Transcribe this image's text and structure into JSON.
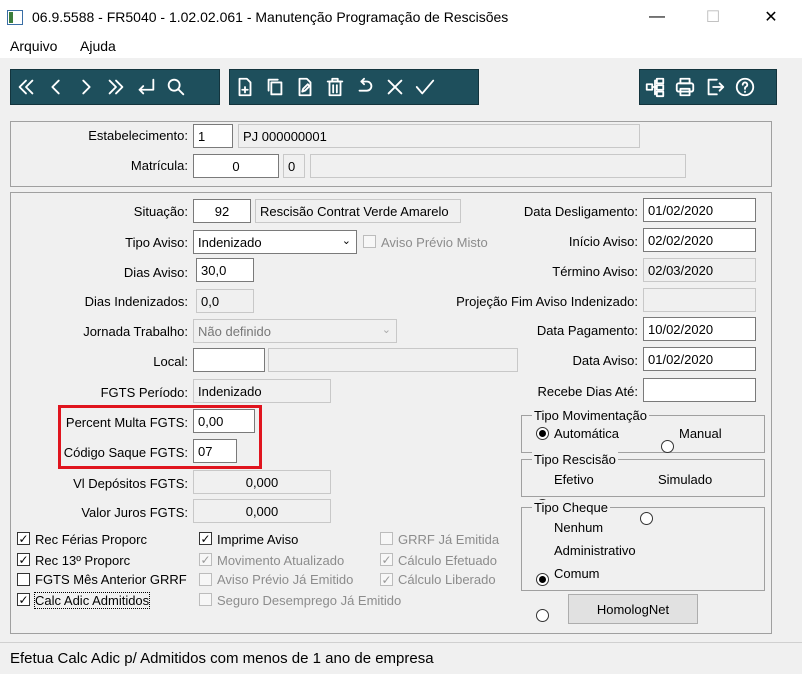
{
  "window": {
    "title": "06.9.5588 - FR5040 - 1.02.02.061 - Manutenção Programação de Rescisões",
    "minimize": "—",
    "maximize": "☐",
    "close": "✕"
  },
  "menu": [
    "Arquivo",
    "Ajuda"
  ],
  "toolbar": {
    "nav_icons": [
      "first-icon",
      "prev-icon",
      "next-icon",
      "last-icon",
      "return-icon",
      "search-icon"
    ],
    "edit_icons": [
      "new-icon",
      "copy-icon",
      "edit-icon",
      "delete-icon",
      "undo-icon",
      "cancel-icon",
      "confirm-icon"
    ],
    "right_icons": [
      "tree-icon",
      "print-icon",
      "exit-icon",
      "help-icon"
    ],
    "color": "#1e4f5c"
  },
  "header": {
    "estabelecimento_label": "Estabelecimento:",
    "estabelecimento_value": "1",
    "estabelecimento_desc": "PJ 000000001",
    "matricula_label": "Matrícula:",
    "matricula_value": "0",
    "matricula_digit": "0",
    "matricula_name": ""
  },
  "form": {
    "situacao_label": "Situação:",
    "situacao_value": "92",
    "situacao_desc": "Rescisão Contrat Verde Amarelo",
    "tipo_aviso_label": "Tipo Aviso:",
    "tipo_aviso_value": "Indenizado",
    "aviso_previo_misto": "Aviso Prévio Misto",
    "dias_aviso_label": "Dias Aviso:",
    "dias_aviso_value": "30,0",
    "dias_indenizados_label": "Dias Indenizados:",
    "dias_indenizados_value": "0,0",
    "jornada_label": "Jornada Trabalho:",
    "jornada_value": "Não definido",
    "local_label": "Local:",
    "local_value": "",
    "local_desc": "",
    "fgts_periodo_label": "FGTS Período:",
    "fgts_periodo_value": "Indenizado",
    "percent_multa_label": "Percent Multa FGTS:",
    "percent_multa_value": "0,00",
    "codigo_saque_label": "Código Saque FGTS:",
    "codigo_saque_value": "07",
    "vl_depositos_label": "Vl Depósitos FGTS:",
    "vl_depositos_value": "0,000",
    "valor_juros_label": "Valor Juros FGTS:",
    "valor_juros_value": "0,000",
    "data_deslig_label": "Data Desligamento:",
    "data_deslig_value": "01/02/2020",
    "inicio_aviso_label": "Início Aviso:",
    "inicio_aviso_value": "02/02/2020",
    "termino_aviso_label": "Término Aviso:",
    "termino_aviso_value": "02/03/2020",
    "projecao_label": "Projeção Fim Aviso Indenizado:",
    "projecao_value": "",
    "data_pagamento_label": "Data Pagamento:",
    "data_pagamento_value": "10/02/2020",
    "data_aviso_label": "Data Aviso:",
    "data_aviso_value": "01/02/2020",
    "recebe_dias_label": "Recebe Dias Até:",
    "recebe_dias_value": ""
  },
  "checkboxes": {
    "rec_ferias": "Rec Férias Proporc",
    "rec_13": "Rec 13º Proporc",
    "fgts_mes_anterior": "FGTS Mês Anterior GRRF",
    "calc_adic": "Calc Adic Admitidos",
    "imprime_aviso": "Imprime Aviso",
    "movimento_atualizado": "Movimento Atualizado",
    "aviso_previo_emitido": "Aviso Prévio Já Emitido",
    "seguro_desemprego": "Seguro Desemprego Já Emitido",
    "grrf_emitida": "GRRF Já Emitida",
    "calculo_efetuado": "Cálculo Efetuado",
    "calculo_liberado": "Cálculo Liberado"
  },
  "tipo_movimentacao": {
    "legend": "Tipo Movimentação",
    "options": [
      "Automática",
      "Manual"
    ],
    "selected": "Automática"
  },
  "tipo_rescisao": {
    "legend": "Tipo Rescisão",
    "options": [
      "Efetivo",
      "Simulado"
    ],
    "selected": "Efetivo"
  },
  "tipo_cheque": {
    "legend": "Tipo Cheque",
    "options": [
      "Nenhum",
      "Administrativo",
      "Comum"
    ],
    "selected": "Nenhum"
  },
  "homolognet_label": "HomologNet",
  "status": "Efetua Calc Adic p/ Admitidos com menos de 1 ano de empresa",
  "highlight_color": "#e0141e"
}
